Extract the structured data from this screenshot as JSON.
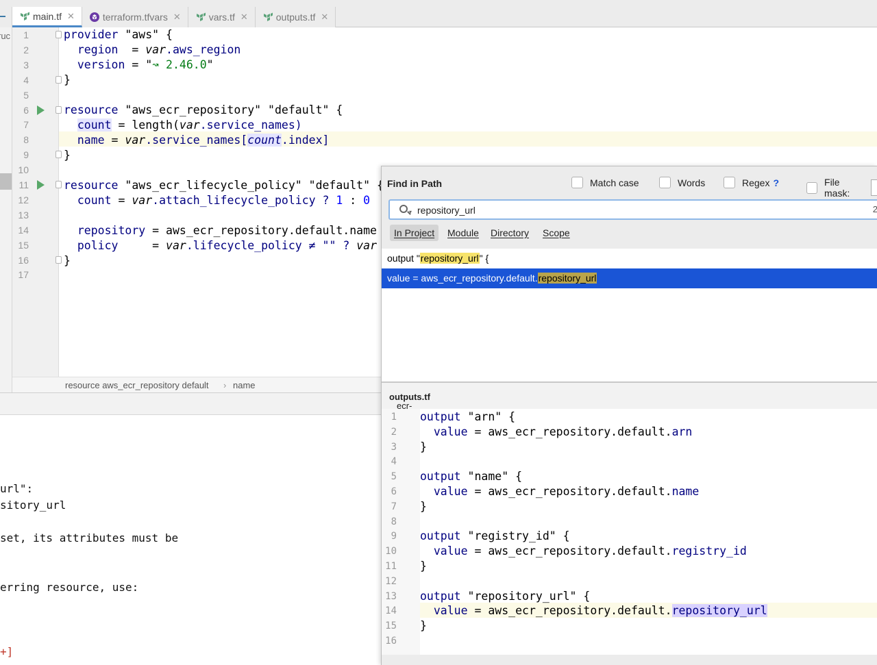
{
  "tabs": [
    {
      "label": "main.tf",
      "active": true,
      "icon": "terraform-icon"
    },
    {
      "label": "terraform.tfvars",
      "active": false,
      "icon": "terraform-vars-icon"
    },
    {
      "label": "vars.tf",
      "active": false,
      "icon": "terraform-icon"
    },
    {
      "label": "outputs.tf",
      "active": false,
      "icon": "terraform-icon"
    }
  ],
  "structure_label": "ruc",
  "editor": {
    "line_numbers": [
      "1",
      "2",
      "3",
      "4",
      "5",
      "6",
      "7",
      "8",
      "9",
      "10",
      "11",
      "12",
      "13",
      "14",
      "15",
      "16",
      "17"
    ],
    "breadcrumb": [
      "resource aws_ecr_repository default",
      "name"
    ],
    "breadcrumb_sep": "›",
    "code": {
      "l1": [
        "provider",
        " \"aws\" {"
      ],
      "l2": [
        "  region",
        "  = ",
        "var",
        ".aws_region"
      ],
      "l3": [
        "  version",
        " = \"",
        "↝ 2.46.0",
        "\""
      ],
      "l4": "}",
      "l6": [
        "resource",
        " \"aws_ecr_repository\" \"default\" {"
      ],
      "l7": [
        "  ",
        "count",
        " = length(",
        "var",
        ".service_names)"
      ],
      "l8": [
        "  name",
        " = ",
        "var",
        ".service_names[",
        "count",
        ".index]"
      ],
      "l9": "}",
      "l11": [
        "resource",
        " \"aws_ecr_lifecycle_policy\" \"default\" {"
      ],
      "l12": [
        "  count",
        " = ",
        "var",
        ".attach_lifecycle_policy ? ",
        "1",
        " : ",
        "0"
      ],
      "l14": [
        "  repository",
        " = aws_ecr_repository.default.name"
      ],
      "l15": [
        "  policy",
        "     = ",
        "var",
        ".lifecycle_policy ≠ \"\" ? ",
        "var"
      ],
      "l16": "}"
    }
  },
  "bottom_panel": {
    "lines": [
      "url\":",
      "sitory_url",
      "set, its attributes must be",
      "erring resource, use:",
      "+]"
    ]
  },
  "find_in_path": {
    "title": "Find in Path",
    "options": [
      {
        "label": "Match case",
        "checked": false
      },
      {
        "label": "Words",
        "checked": false
      },
      {
        "label": "Regex",
        "checked": false,
        "help": "?"
      },
      {
        "label": "File mask:",
        "checked": false
      }
    ],
    "search": {
      "value": "repository_url",
      "count": "2"
    },
    "scopes": [
      "In Project",
      "Module",
      "Directory",
      "Scope"
    ],
    "selected_scope": "In Project",
    "results": [
      {
        "before": "output \"",
        "match": "repository_url",
        "after": "\" {",
        "selected": false
      },
      {
        "before": "value = aws_ecr_repository.default.",
        "match": "repository_url",
        "after": "",
        "selected": true
      }
    ],
    "preview_path": {
      "dir": "ecr-services/",
      "file": "outputs.tf"
    },
    "preview": {
      "line_numbers": [
        "1",
        "2",
        "3",
        "4",
        "5",
        "6",
        "7",
        "8",
        "9",
        "10",
        "11",
        "12",
        "13",
        "14",
        "15",
        "16"
      ],
      "lines": [
        [
          "output",
          " \"arn\" {"
        ],
        [
          "  value",
          " = aws_ecr_repository.default.",
          "arn"
        ],
        [
          "}"
        ],
        [
          ""
        ],
        [
          "output",
          " \"name\" {"
        ],
        [
          "  value",
          " = aws_ecr_repository.default.",
          "name"
        ],
        [
          "}"
        ],
        [
          ""
        ],
        [
          "output",
          " \"registry_id\" {"
        ],
        [
          "  value",
          " = aws_ecr_repository.default.",
          "registry_id"
        ],
        [
          "}"
        ],
        [
          ""
        ],
        [
          "output",
          " \"repository_url\" {"
        ],
        [
          "  value",
          " = aws_ecr_repository.default.",
          "repository_url"
        ],
        [
          "}"
        ],
        [
          ""
        ]
      ]
    }
  },
  "colors": {
    "accent": "#1a55d6",
    "match": "#f7e36b",
    "run": "#59a869",
    "keyword": "#000080"
  }
}
